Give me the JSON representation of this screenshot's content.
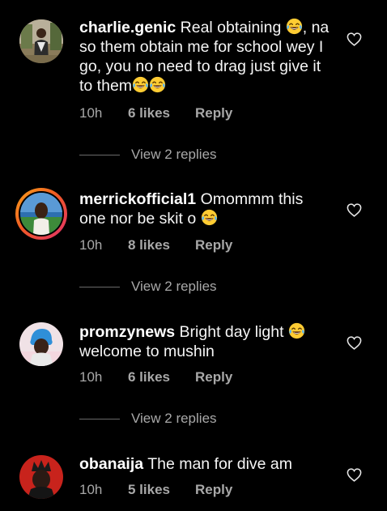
{
  "comments": [
    {
      "username": "charlie.genic",
      "text_parts": [
        "Real obtaining ",
        ", na so them obtain me for school wey I go, you no need to drag just give it to them"
      ],
      "time": "10h",
      "likes": "6 likes",
      "reply_label": "Reply",
      "view_replies": "View 2 replies"
    },
    {
      "username": "merrickofficial1",
      "text_parts": [
        "Omommm this one nor be skit o "
      ],
      "time": "10h",
      "likes": "8 likes",
      "reply_label": "Reply",
      "view_replies": "View 2 replies"
    },
    {
      "username": "promzynews",
      "text_parts": [
        "Bright day light ",
        "welcome to mushin"
      ],
      "time": "10h",
      "likes": "6 likes",
      "reply_label": "Reply",
      "view_replies": "View 2 replies"
    },
    {
      "username": "obanaija",
      "text_parts": [
        "The man for dive am"
      ],
      "time": "10h",
      "likes": "5 likes",
      "reply_label": "Reply"
    }
  ],
  "icons": {
    "like": "heart-outline-icon",
    "emoji": "face-with-tears-of-joy-emoji"
  },
  "colors": {
    "background": "#000000",
    "text": "#f5f5f5",
    "meta": "#a8a8a8",
    "story_ring_start": "#f7a21a",
    "story_ring_end": "#e1306c"
  }
}
